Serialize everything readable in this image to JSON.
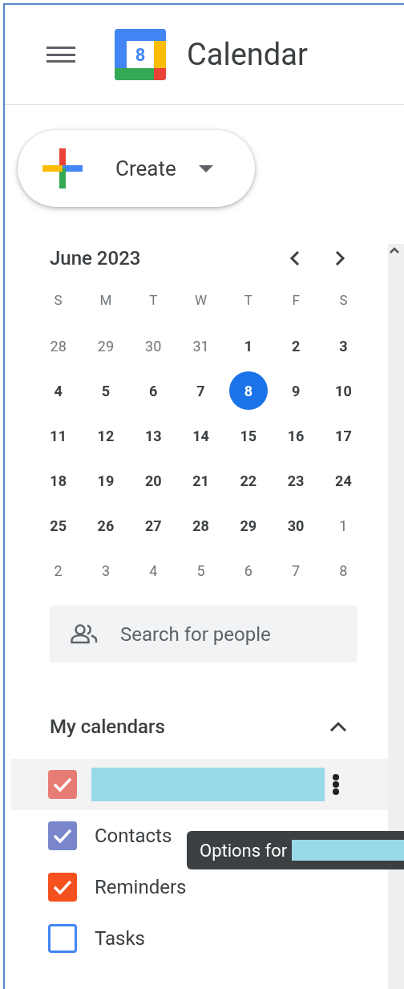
{
  "header": {
    "title": "Calendar",
    "logo_day": "8"
  },
  "create_button": {
    "label": "Create"
  },
  "mini_calendar": {
    "title": "June 2023",
    "weekdays": [
      "S",
      "M",
      "T",
      "W",
      "T",
      "F",
      "S"
    ],
    "weeks": [
      [
        {
          "day": "28",
          "in_month": false,
          "today": false
        },
        {
          "day": "29",
          "in_month": false,
          "today": false
        },
        {
          "day": "30",
          "in_month": false,
          "today": false
        },
        {
          "day": "31",
          "in_month": false,
          "today": false
        },
        {
          "day": "1",
          "in_month": true,
          "today": false
        },
        {
          "day": "2",
          "in_month": true,
          "today": false
        },
        {
          "day": "3",
          "in_month": true,
          "today": false
        }
      ],
      [
        {
          "day": "4",
          "in_month": true,
          "today": false
        },
        {
          "day": "5",
          "in_month": true,
          "today": false
        },
        {
          "day": "6",
          "in_month": true,
          "today": false
        },
        {
          "day": "7",
          "in_month": true,
          "today": false
        },
        {
          "day": "8",
          "in_month": true,
          "today": true
        },
        {
          "day": "9",
          "in_month": true,
          "today": false
        },
        {
          "day": "10",
          "in_month": true,
          "today": false
        }
      ],
      [
        {
          "day": "11",
          "in_month": true,
          "today": false
        },
        {
          "day": "12",
          "in_month": true,
          "today": false
        },
        {
          "day": "13",
          "in_month": true,
          "today": false
        },
        {
          "day": "14",
          "in_month": true,
          "today": false
        },
        {
          "day": "15",
          "in_month": true,
          "today": false
        },
        {
          "day": "16",
          "in_month": true,
          "today": false
        },
        {
          "day": "17",
          "in_month": true,
          "today": false
        }
      ],
      [
        {
          "day": "18",
          "in_month": true,
          "today": false
        },
        {
          "day": "19",
          "in_month": true,
          "today": false
        },
        {
          "day": "20",
          "in_month": true,
          "today": false
        },
        {
          "day": "21",
          "in_month": true,
          "today": false
        },
        {
          "day": "22",
          "in_month": true,
          "today": false
        },
        {
          "day": "23",
          "in_month": true,
          "today": false
        },
        {
          "day": "24",
          "in_month": true,
          "today": false
        }
      ],
      [
        {
          "day": "25",
          "in_month": true,
          "today": false
        },
        {
          "day": "26",
          "in_month": true,
          "today": false
        },
        {
          "day": "27",
          "in_month": true,
          "today": false
        },
        {
          "day": "28",
          "in_month": true,
          "today": false
        },
        {
          "day": "29",
          "in_month": true,
          "today": false
        },
        {
          "day": "30",
          "in_month": true,
          "today": false
        },
        {
          "day": "1",
          "in_month": false,
          "today": false
        }
      ],
      [
        {
          "day": "2",
          "in_month": false,
          "today": false
        },
        {
          "day": "3",
          "in_month": false,
          "today": false
        },
        {
          "day": "4",
          "in_month": false,
          "today": false
        },
        {
          "day": "5",
          "in_month": false,
          "today": false
        },
        {
          "day": "6",
          "in_month": false,
          "today": false
        },
        {
          "day": "7",
          "in_month": false,
          "today": false
        },
        {
          "day": "8",
          "in_month": false,
          "today": false
        }
      ]
    ]
  },
  "search_people": {
    "placeholder": "Search for people"
  },
  "my_calendars": {
    "title": "My calendars",
    "expanded": true,
    "items": [
      {
        "kind": "redacted",
        "checked": true,
        "color": "#e67c73",
        "hovered": true
      },
      {
        "kind": "text",
        "name": "Contacts",
        "checked": true,
        "color": "#7986cb",
        "hovered": false
      },
      {
        "kind": "text",
        "name": "Reminders",
        "checked": true,
        "color": "#f4511e",
        "hovered": false
      },
      {
        "kind": "text",
        "name": "Tasks",
        "checked": false,
        "color": "#4285f4",
        "hovered": false
      }
    ]
  },
  "tooltip": {
    "text": "Options for"
  }
}
